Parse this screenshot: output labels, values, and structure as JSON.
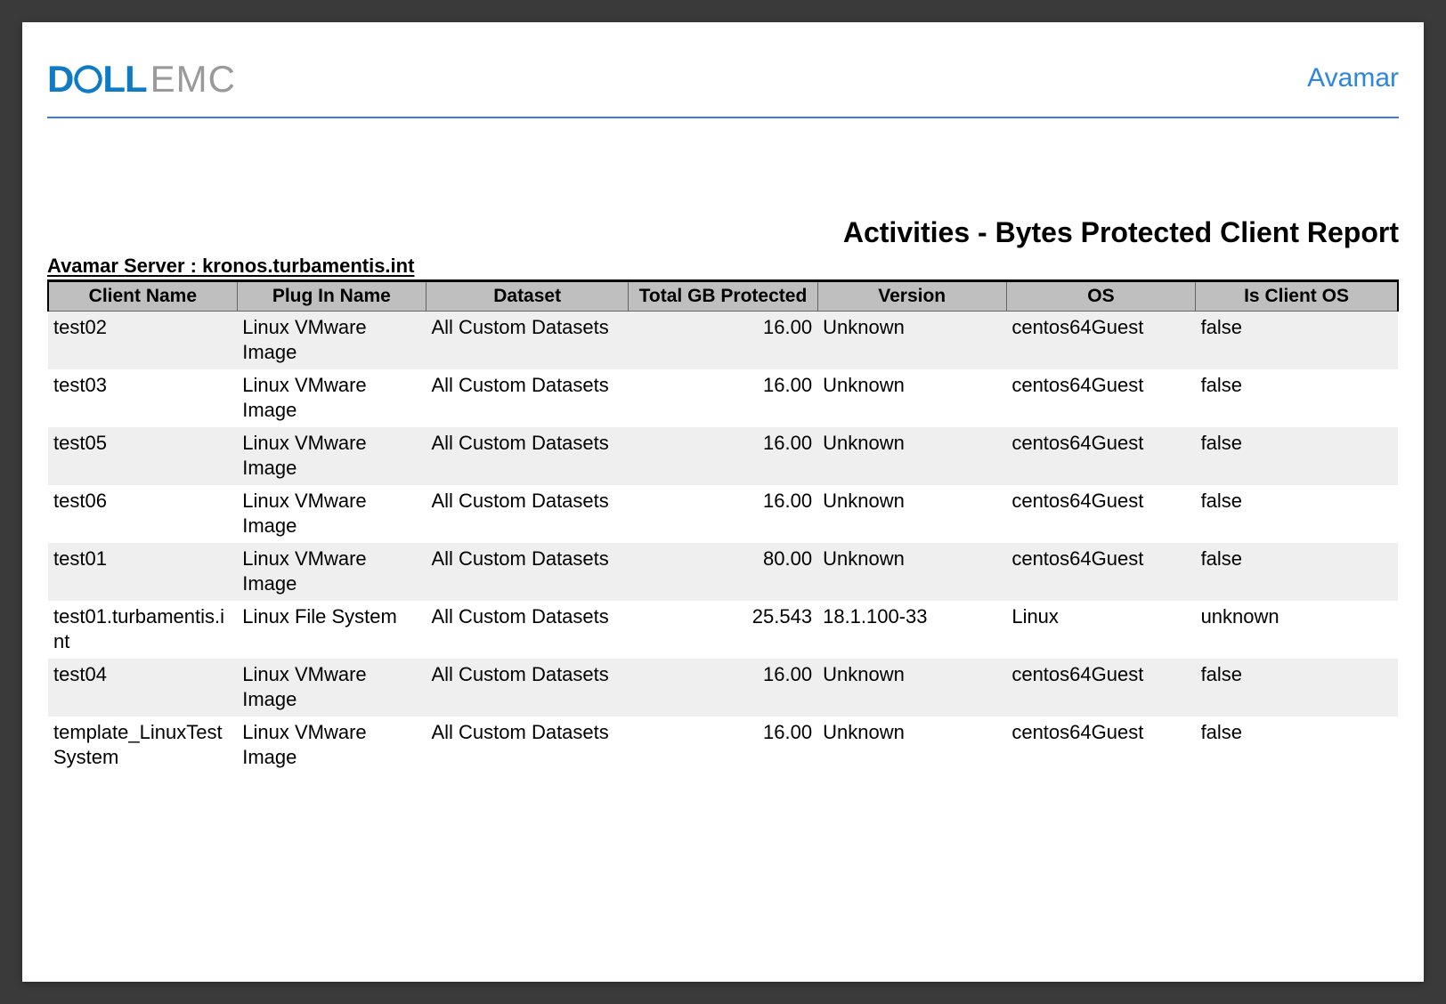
{
  "brand": {
    "dell_d": "D",
    "dell_ll": "LL",
    "emc": "EMC",
    "product": "Avamar"
  },
  "report": {
    "title": "Activities - Bytes Protected Client Report",
    "server_label": "Avamar Server : kronos.turbamentis.int"
  },
  "columns": {
    "c0": "Client Name",
    "c1": "Plug In Name",
    "c2": "Dataset",
    "c3": "Total GB Protected",
    "c4": "Version",
    "c5": "OS",
    "c6": "Is Client OS"
  },
  "rows": [
    {
      "client": "test02",
      "plugin": "Linux VMware Image",
      "dataset": "All Custom Datasets",
      "total": "16.00",
      "version": "Unknown",
      "os": "centos64Guest",
      "isclient": "false"
    },
    {
      "client": "test03",
      "plugin": "Linux VMware Image",
      "dataset": "All Custom Datasets",
      "total": "16.00",
      "version": "Unknown",
      "os": "centos64Guest",
      "isclient": "false"
    },
    {
      "client": "test05",
      "plugin": "Linux VMware Image",
      "dataset": "All Custom Datasets",
      "total": "16.00",
      "version": "Unknown",
      "os": "centos64Guest",
      "isclient": "false"
    },
    {
      "client": "test06",
      "plugin": "Linux VMware Image",
      "dataset": "All Custom Datasets",
      "total": "16.00",
      "version": "Unknown",
      "os": "centos64Guest",
      "isclient": "false"
    },
    {
      "client": "test01",
      "plugin": "Linux VMware Image",
      "dataset": "All Custom Datasets",
      "total": "80.00",
      "version": "Unknown",
      "os": "centos64Guest",
      "isclient": "false"
    },
    {
      "client": "test01.turbamentis.int",
      "plugin": "Linux File System",
      "dataset": "All Custom Datasets",
      "total": "25.543",
      "version": "18.1.100-33",
      "os": "Linux",
      "isclient": "unknown"
    },
    {
      "client": "test04",
      "plugin": "Linux VMware Image",
      "dataset": "All Custom Datasets",
      "total": "16.00",
      "version": "Unknown",
      "os": "centos64Guest",
      "isclient": "false"
    },
    {
      "client": "template_LinuxTestSystem",
      "plugin": "Linux VMware Image",
      "dataset": "All Custom Datasets",
      "total": "16.00",
      "version": "Unknown",
      "os": "centos64Guest",
      "isclient": "false"
    }
  ]
}
